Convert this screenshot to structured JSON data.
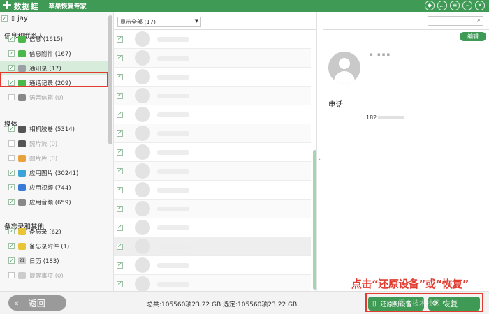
{
  "titlebar": {
    "logo_mark": "✚",
    "logo_text": "数据蛙",
    "subtitle": "苹果恢复专家",
    "controls": [
      "gem-icon",
      "chat-icon",
      "menu-icon",
      "minimize-icon",
      "close-icon"
    ]
  },
  "sidebar": {
    "device": "jay",
    "groups": [
      {
        "label": "信息和联系人"
      },
      {
        "label": "媒体"
      },
      {
        "label": "备忘录和其他"
      }
    ],
    "items": [
      {
        "label": "信息 (1615)",
        "checked": true,
        "enabled": true,
        "icon": "message-icon",
        "color": "#4cb84c"
      },
      {
        "label": "信息附件 (167)",
        "checked": true,
        "enabled": true,
        "icon": "message-attachment-icon",
        "color": "#4cb84c"
      },
      {
        "label": "通讯录 (17)",
        "checked": true,
        "enabled": true,
        "icon": "contacts-icon",
        "color": "#9aa0a6",
        "selected": true
      },
      {
        "label": "通话记录 (209)",
        "checked": true,
        "enabled": true,
        "icon": "phone-icon",
        "color": "#4cb84c"
      },
      {
        "label": "语音信箱 (0)",
        "checked": false,
        "enabled": false,
        "icon": "voicemail-icon",
        "color": "#888888"
      },
      {
        "label": "相机胶卷 (5314)",
        "checked": true,
        "enabled": true,
        "icon": "camera-icon",
        "color": "#555555"
      },
      {
        "label": "照片流 (0)",
        "checked": false,
        "enabled": false,
        "icon": "photo-stream-icon",
        "color": "#555555"
      },
      {
        "label": "图片库 (0)",
        "checked": false,
        "enabled": false,
        "icon": "photo-library-icon",
        "color": "#e9a23b"
      },
      {
        "label": "应用图片 (30241)",
        "checked": true,
        "enabled": true,
        "icon": "app-photo-icon",
        "color": "#3aa3d8"
      },
      {
        "label": "应用视频 (744)",
        "checked": true,
        "enabled": true,
        "icon": "app-video-icon",
        "color": "#3a7bd8"
      },
      {
        "label": "应用音频 (659)",
        "checked": true,
        "enabled": true,
        "icon": "app-audio-icon",
        "color": "#888888"
      },
      {
        "label": "备忘录 (62)",
        "checked": true,
        "enabled": true,
        "icon": "notes-icon",
        "color": "#e8c437"
      },
      {
        "label": "备忘录附件 (1)",
        "checked": true,
        "enabled": true,
        "icon": "notes-attachment-icon",
        "color": "#e8c437"
      },
      {
        "label": "日历 (183)",
        "checked": true,
        "enabled": true,
        "icon": "calendar-icon",
        "color": "#cccccc",
        "glyph": "21"
      },
      {
        "label": "提醒事项 (0)",
        "checked": false,
        "enabled": false,
        "icon": "reminders-icon",
        "color": "#cccccc"
      }
    ]
  },
  "list": {
    "filter": "显示全部 (17)",
    "checked_count": 14,
    "highlighted_row": 11
  },
  "detail": {
    "edit": "编辑",
    "phone_label": "电话",
    "phone_prefix": "182"
  },
  "bottom": {
    "back": "返回",
    "total": "总共:105560项23.22 GB 选定:105560项23.22 GB",
    "restore_device": "还原到设备",
    "recover": "恢复",
    "annotation": "点击“还原设备”或“恢复”",
    "watermark": "@掘金技术社区"
  },
  "colors": {
    "brand_green": "#3f9a55",
    "highlight_red": "#e23b30"
  }
}
